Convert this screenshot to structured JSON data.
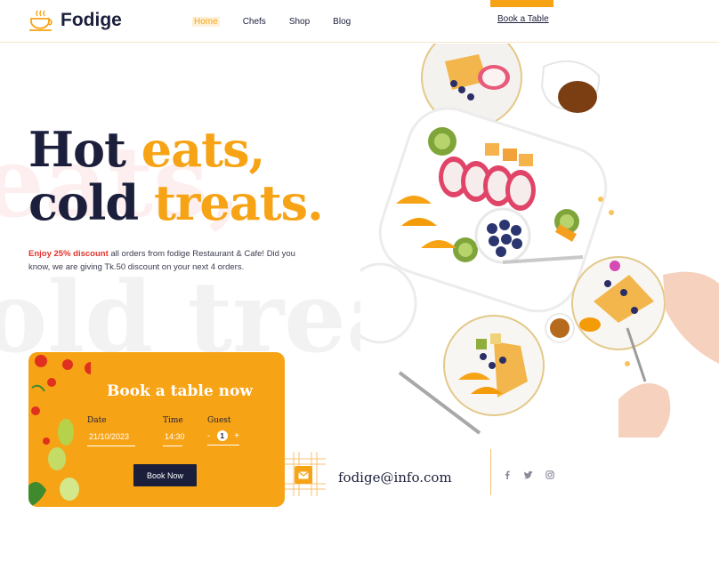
{
  "brand": {
    "name": "Fodige",
    "logo_icon": "coffee-cup-icon"
  },
  "nav": {
    "items": [
      {
        "label": "Home",
        "active": true
      },
      {
        "label": "Chefs",
        "active": false
      },
      {
        "label": "Shop",
        "active": false
      },
      {
        "label": "Blog",
        "active": false
      }
    ],
    "cta": "Book a Table"
  },
  "hero": {
    "line1_a": "Hot ",
    "line1_b": "eats,",
    "line2_a": "cold ",
    "line2_b": "treats.",
    "desc_highlight": "Enjoy 25% discount",
    "desc_rest": " all orders from fodige Restaurant & Cafe! Did you know, we are giving Tk.50 discount on your next 4 orders.",
    "watermark1": "eats,",
    "watermark2": "old treats"
  },
  "booking": {
    "title": "Book a table now",
    "date_label": "Date",
    "date_value": "21/10/2023",
    "time_label": "Time",
    "time_value": "14:30",
    "guest_label": "Guest",
    "guest_minus": "-",
    "guest_value": "1",
    "guest_plus": "+",
    "button": "Book Now"
  },
  "contact": {
    "email": "fodige@info.com",
    "email_icon": "envelope-icon",
    "socials": [
      "facebook-icon",
      "twitter-icon",
      "instagram-icon"
    ]
  },
  "colors": {
    "accent": "#f7a316",
    "navy": "#1b1f3b",
    "highlight": "#e2342c"
  }
}
